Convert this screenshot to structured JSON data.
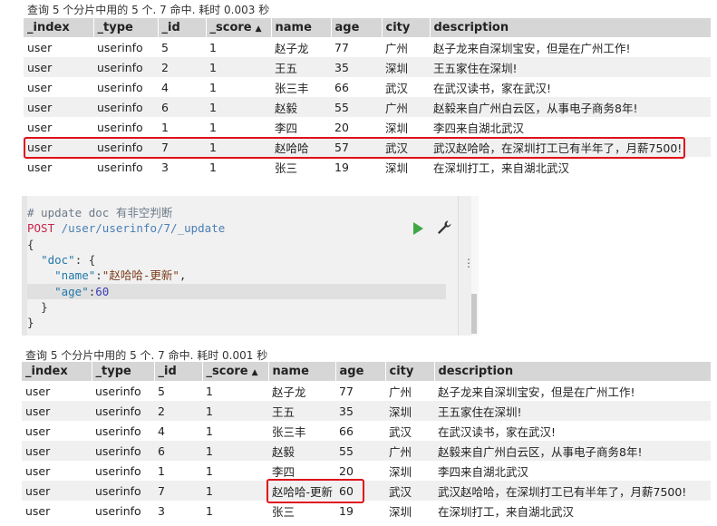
{
  "top": {
    "meta": "查询 5 个分片中用的 5 个. 7 命中. 耗时 0.003 秒",
    "headers": [
      "_index",
      "_type",
      "_id",
      "_score",
      "name",
      "age",
      "city",
      "description"
    ],
    "rows": [
      [
        "user",
        "userinfo",
        "5",
        "1",
        "赵子龙",
        "77",
        "广州",
        "赵子龙来自深圳宝安，但是在广州工作!"
      ],
      [
        "user",
        "userinfo",
        "2",
        "1",
        "王五",
        "35",
        "深圳",
        "王五家住在深圳!"
      ],
      [
        "user",
        "userinfo",
        "4",
        "1",
        "张三丰",
        "66",
        "武汉",
        "在武汉读书，家在武汉!"
      ],
      [
        "user",
        "userinfo",
        "6",
        "1",
        "赵毅",
        "55",
        "广州",
        "赵毅来自广州白云区，从事电子商务8年!"
      ],
      [
        "user",
        "userinfo",
        "1",
        "1",
        "李四",
        "20",
        "深圳",
        "李四来自湖北武汉"
      ],
      [
        "user",
        "userinfo",
        "7",
        "1",
        "赵哈哈",
        "57",
        "武汉",
        "武汉赵哈哈，在深圳打工已有半年了，月薪7500!"
      ],
      [
        "user",
        "userinfo",
        "3",
        "1",
        "张三",
        "19",
        "深圳",
        "在深圳打工，来自湖北武汉"
      ]
    ]
  },
  "editor": {
    "comment": "# update doc 有非空判断",
    "method": "POST",
    "url": "/user/userinfo/7/_update",
    "open_brace": "{",
    "doc_key": "\"doc\"",
    "doc_open": ": {",
    "name_key": "\"name\"",
    "name_val": "\"赵哈哈-更新\"",
    "age_key": "\"age\"",
    "age_val": "60",
    "inner_close": "}",
    "close_brace": "}",
    "comma": ",",
    "colon": ":",
    "side_dots": "⋮"
  },
  "bottom": {
    "meta": "查询 5 个分片中用的 5 个. 7 命中. 耗时 0.001 秒",
    "headers": [
      "_index",
      "_type",
      "_id",
      "_score",
      "name",
      "age",
      "city",
      "description"
    ],
    "rows": [
      [
        "user",
        "userinfo",
        "5",
        "1",
        "赵子龙",
        "77",
        "广州",
        "赵子龙来自深圳宝安，但是在广州工作!"
      ],
      [
        "user",
        "userinfo",
        "2",
        "1",
        "王五",
        "35",
        "深圳",
        "王五家住在深圳!"
      ],
      [
        "user",
        "userinfo",
        "4",
        "1",
        "张三丰",
        "66",
        "武汉",
        "在武汉读书，家在武汉!"
      ],
      [
        "user",
        "userinfo",
        "6",
        "1",
        "赵毅",
        "55",
        "广州",
        "赵毅来自广州白云区，从事电子商务8年!"
      ],
      [
        "user",
        "userinfo",
        "1",
        "1",
        "李四",
        "20",
        "深圳",
        "李四来自湖北武汉"
      ],
      [
        "user",
        "userinfo",
        "7",
        "1",
        "赵哈哈-更新",
        "60",
        "武汉",
        "武汉赵哈哈，在深圳打工已有半年了，月薪7500!"
      ],
      [
        "user",
        "userinfo",
        "3",
        "1",
        "张三",
        "19",
        "深圳",
        "在深圳打工，来自湖北武汉"
      ]
    ]
  },
  "sort_indicator": "▲",
  "colors": {
    "highlight": "#e0101a",
    "run": "#3fa844"
  },
  "icons": [
    "play-icon",
    "wrench-icon",
    "sort-asc-icon"
  ]
}
